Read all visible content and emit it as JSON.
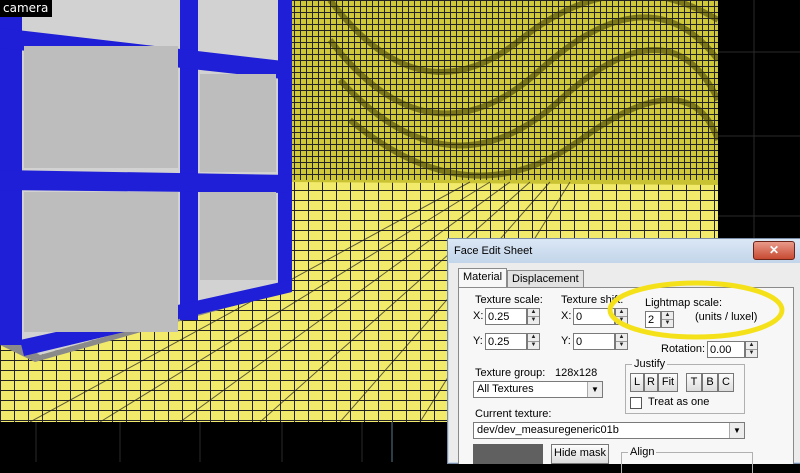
{
  "viewport": {
    "label": "camera"
  },
  "dialog": {
    "title": "Face Edit Sheet",
    "close_glyph": "✕",
    "tabs": [
      {
        "label": "Material"
      },
      {
        "label": "Displacement"
      }
    ],
    "texture_scale": {
      "label": "Texture scale:",
      "x_label": "X:",
      "x_value": "0.25",
      "y_label": "Y:",
      "y_value": "0.25"
    },
    "texture_shift": {
      "label": "Texture shift:",
      "x_label": "X:",
      "x_value": "0",
      "y_label": "Y:",
      "y_value": "0"
    },
    "lightmap_scale": {
      "label": "Lightmap scale:",
      "value": "2",
      "units": "(units / luxel)"
    },
    "rotation": {
      "label": "Rotation:",
      "value": "0.00"
    },
    "texture_group": {
      "label": "Texture group:",
      "size": "128x128",
      "selected": "All Textures"
    },
    "justify": {
      "label": "Justify",
      "buttons": [
        "L",
        "R",
        "Fit",
        "T",
        "B",
        "C"
      ],
      "treat_as_one": "Treat as one"
    },
    "current_texture": {
      "label": "Current texture:",
      "value": "dev/dev_measuregeneric01b"
    },
    "hide_mask": "Hide mask",
    "align": {
      "label": "Align"
    }
  },
  "colors": {
    "floor": "#f2ea6a",
    "wall": "#c9c233",
    "cube_edge": "#1f1fd8",
    "cube_face": "#d2d2d2",
    "highlight_ellipse": "#f5e11a"
  }
}
